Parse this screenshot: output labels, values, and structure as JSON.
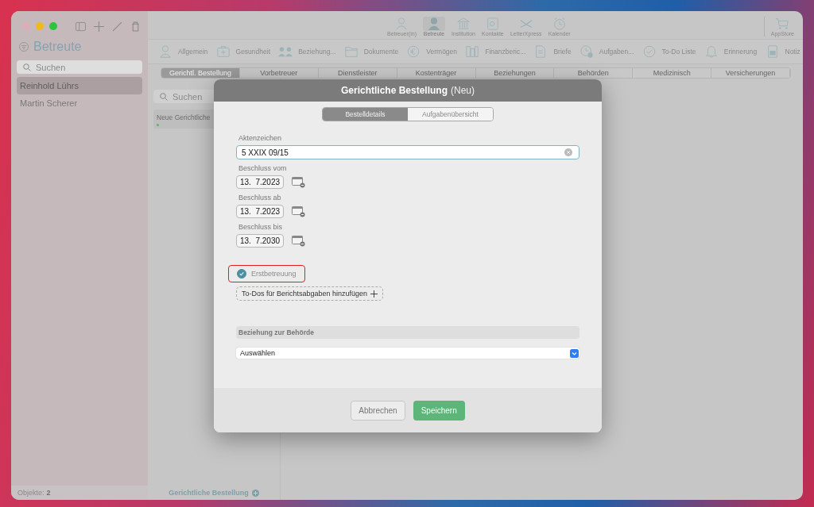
{
  "sidebar": {
    "title": "Betreute",
    "search": {
      "placeholder": "Suchen"
    },
    "items": [
      {
        "label": "Reinhold Lührs",
        "selected": true
      },
      {
        "label": "Martin Scherer",
        "selected": false
      }
    ],
    "footer": {
      "label": "Objekte:",
      "count": "2"
    }
  },
  "toolbar": {
    "items": [
      {
        "label": "Betreuer(in)",
        "selected": false
      },
      {
        "label": "Betreute",
        "selected": true
      },
      {
        "label": "Institution",
        "selected": false
      },
      {
        "label": "Kontakte",
        "selected": false
      },
      {
        "label": "LetterXpress",
        "selected": false
      },
      {
        "label": "Kalender",
        "selected": false
      }
    ],
    "store": "AppStore"
  },
  "categories": [
    "Allgemein",
    "Gesundheit",
    "Beziehung...",
    "Dokumente",
    "Vermögen",
    "Finanzberic...",
    "Briefe",
    "Aufgaben...",
    "To-Do Liste",
    "Erinnerung",
    "Notiz"
  ],
  "subtabs": [
    {
      "label": "Gerichtl. Bestellung",
      "selected": true
    },
    {
      "label": "Vorbetreuer",
      "selected": false
    },
    {
      "label": "Dienstleister",
      "selected": false
    },
    {
      "label": "Kostenträger",
      "selected": false
    },
    {
      "label": "Beziehungen",
      "selected": false
    },
    {
      "label": "Behörden",
      "selected": false
    },
    {
      "label": "Medizinisch",
      "selected": false
    },
    {
      "label": "Versicherungen",
      "selected": false
    }
  ],
  "list": {
    "search": {
      "placeholder": "Suchen"
    },
    "items": [
      {
        "label": "Neue Gerichtliche",
        "color": "#5cb85c"
      }
    ],
    "footer": "Gerichtliche Bestellung"
  },
  "dialog": {
    "title": "Gerichtliche Bestellung",
    "title_suffix": "(Neu)",
    "tabs": [
      {
        "label": "Bestelldetails",
        "selected": true
      },
      {
        "label": "Aufgabenübersicht",
        "selected": false
      }
    ],
    "case_number": {
      "label": "Aktenzeichen",
      "value": "5 XXIX 09/15"
    },
    "dates": [
      {
        "label": "Beschluss vom",
        "value": "13.  7.2023"
      },
      {
        "label": "Beschluss ab",
        "value": "13.  7.2023"
      },
      {
        "label": "Beschluss bis",
        "value": "13.  7.2030"
      }
    ],
    "first_care": {
      "label": "Erstbetreuung",
      "checked": true,
      "highlighted": true
    },
    "add_todos": "To-Dos für Berichtsabgaben hinzufügen",
    "authority": {
      "heading": "Beziehung zur Behörde",
      "select": "Auswählen"
    },
    "buttons": {
      "cancel": "Abbrechen",
      "save": "Speichern"
    }
  }
}
